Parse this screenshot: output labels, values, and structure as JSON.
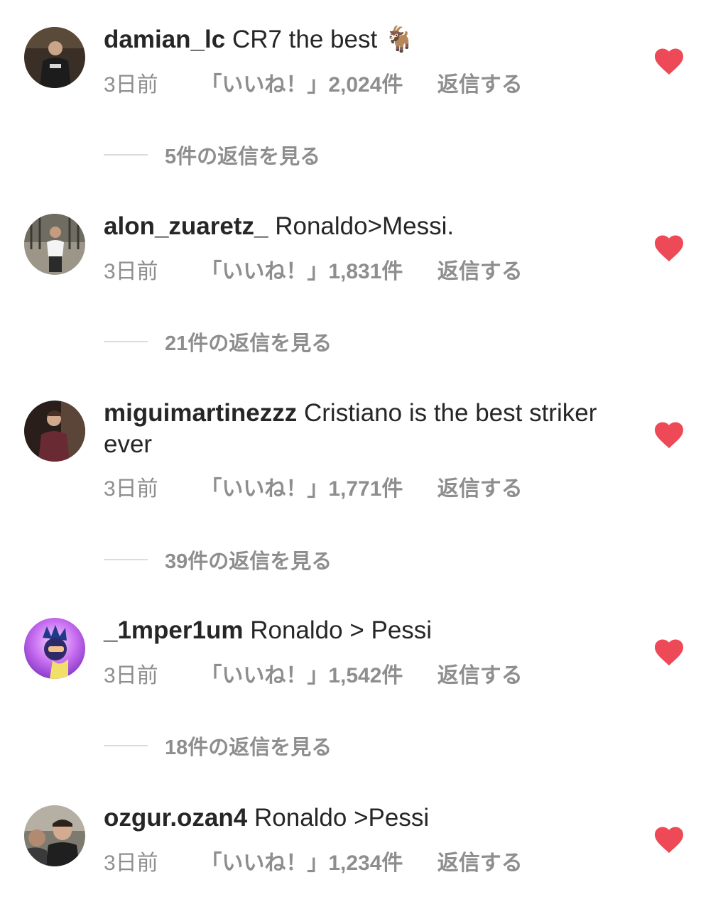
{
  "accent_color": "#ed4956",
  "comments": [
    {
      "username": "damian_lc",
      "text": "CR7 the best 🐐",
      "time": "3日前",
      "likes": "「いいね！」2,024件",
      "reply_label": "返信する",
      "view_replies": "5件の返信を見る",
      "liked": true
    },
    {
      "username": "alon_zuaretz_",
      "text": "Ronaldo>Messi.",
      "time": "3日前",
      "likes": "「いいね！」1,831件",
      "reply_label": "返信する",
      "view_replies": "21件の返信を見る",
      "liked": true
    },
    {
      "username": "miguimartinezzz",
      "text": "Cristiano is the best striker ever",
      "time": "3日前",
      "likes": "「いいね！」1,771件",
      "reply_label": "返信する",
      "view_replies": "39件の返信を見る",
      "liked": true
    },
    {
      "username": "_1mper1um",
      "text": "Ronaldo > Pessi",
      "time": "3日前",
      "likes": "「いいね！」1,542件",
      "reply_label": "返信する",
      "view_replies": "18件の返信を見る",
      "liked": true
    },
    {
      "username": "ozgur.ozan4",
      "text": "Ronaldo >Pessi",
      "time": "3日前",
      "likes": "「いいね！」1,234件",
      "reply_label": "返信する",
      "liked": true
    }
  ]
}
